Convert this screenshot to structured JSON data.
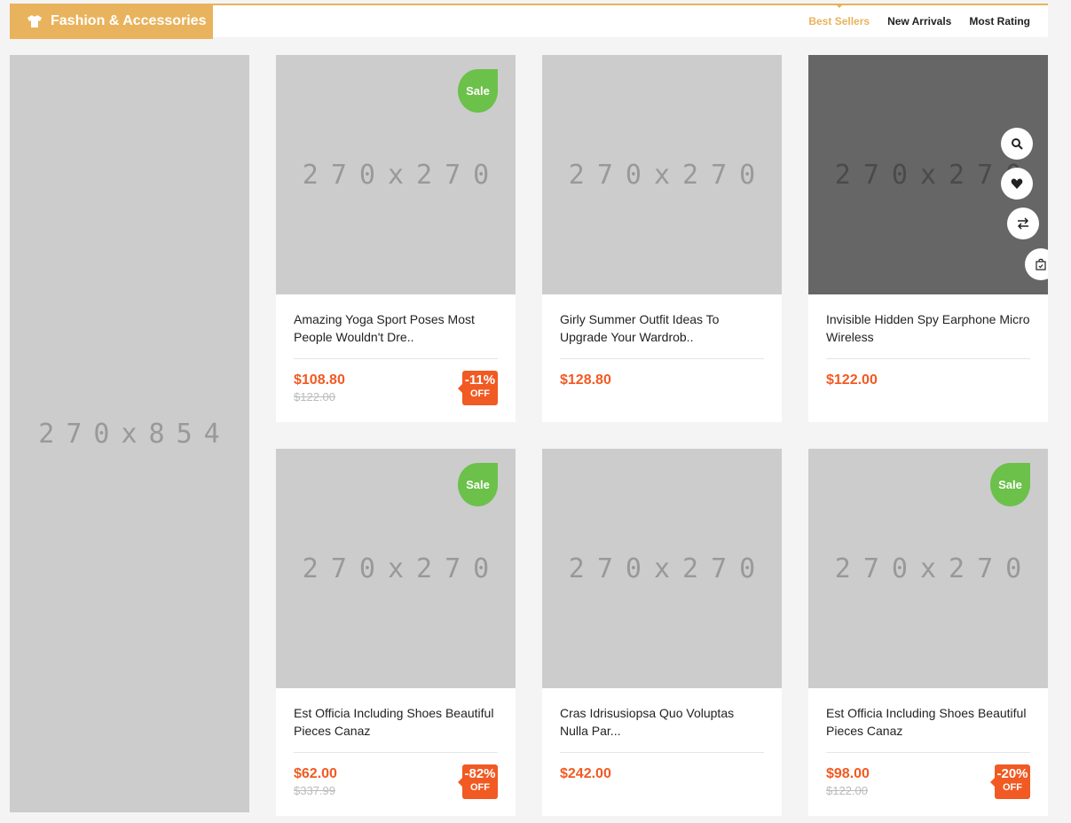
{
  "header": {
    "category_title": "Fashion & Accessories",
    "category_icon": "shirt-icon",
    "accent_color": "#e8b35c",
    "tabs": [
      {
        "label": "Best Sellers",
        "active": true
      },
      {
        "label": "New Arrivals",
        "active": false
      },
      {
        "label": "Most Rating",
        "active": false
      }
    ]
  },
  "banner": {
    "placeholder": "270x854"
  },
  "colors": {
    "price": "#f15a22",
    "sale_badge": "#6bc14a",
    "placeholder": "#cccccc"
  },
  "products": [
    {
      "placeholder": "270x270",
      "sale_badge": "Sale",
      "title": "Amazing Yoga Sport Poses Most People Wouldn't Dre..",
      "price": "$108.80",
      "old_price": "$122.00",
      "discount": "-11%",
      "discount_label": "OFF"
    },
    {
      "placeholder": "270x270",
      "sale_badge": "",
      "title": "Girly Summer Outfit Ideas To Upgrade Your Wardrob..",
      "price": "$128.80",
      "old_price": "",
      "discount": "",
      "discount_label": ""
    },
    {
      "placeholder": "270x270",
      "sale_badge": "",
      "title": "Invisible Hidden Spy Earphone Micro Wireless",
      "price": "$122.00",
      "old_price": "",
      "discount": "",
      "discount_label": "",
      "hovered": true,
      "actions": [
        "search-icon",
        "heart-icon",
        "compare-icon",
        "cart-icon"
      ]
    },
    {
      "placeholder": "270x270",
      "sale_badge": "Sale",
      "title": "Est Officia Including Shoes Beautiful Pieces Canaz",
      "price": "$62.00",
      "old_price": "$337.99",
      "discount": "-82%",
      "discount_label": "OFF"
    },
    {
      "placeholder": "270x270",
      "sale_badge": "",
      "title": "Cras Idrisusiopsa Quo Voluptas Nulla Par...",
      "price": "$242.00",
      "old_price": "",
      "discount": "",
      "discount_label": ""
    },
    {
      "placeholder": "270x270",
      "sale_badge": "Sale",
      "title": "Est Officia Including Shoes Beautiful Pieces Canaz",
      "price": "$98.00",
      "old_price": "$122.00",
      "discount": "-20%",
      "discount_label": "OFF"
    }
  ]
}
